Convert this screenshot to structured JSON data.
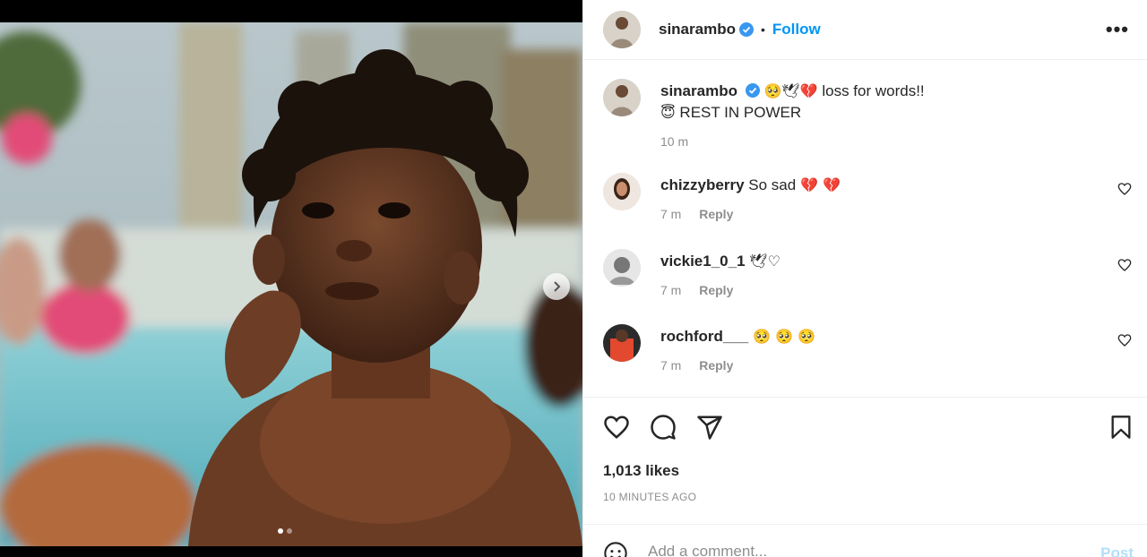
{
  "post": {
    "author": "sinarambo",
    "follow_label": "Follow",
    "separator": "•",
    "more_label": "•••"
  },
  "caption": {
    "username": "sinarambo",
    "emojis": "🥺🕊💔",
    "text": "loss for words!!",
    "line2_emoji": "😇",
    "line2_text": "REST IN POWER",
    "time": "10 m"
  },
  "comments": [
    {
      "username": "chizzyberry",
      "text": "So sad",
      "emojis": "💔 💔",
      "time": "7 m",
      "reply_label": "Reply"
    },
    {
      "username": "vickie1_0_1",
      "text": "",
      "emojis": "🕊♡",
      "time": "7 m",
      "reply_label": "Reply"
    },
    {
      "username": "rochford___",
      "text": "",
      "emojis": "🥺 🥺 🥺",
      "time": "7 m",
      "reply_label": "Reply"
    }
  ],
  "actions": {
    "likes": "1,013 likes",
    "time_ago": "10 MINUTES AGO"
  },
  "comment_box": {
    "placeholder": "Add a comment...",
    "post_label": "Post"
  },
  "colors": {
    "accent": "#0095f6",
    "verified": "#3897f0",
    "post_disabled": "#b2dffc"
  },
  "icons": [
    "heart-icon",
    "comment-icon",
    "share-icon",
    "bookmark-icon",
    "emoji-icon",
    "chevron-right-icon",
    "verified-badge-icon"
  ]
}
